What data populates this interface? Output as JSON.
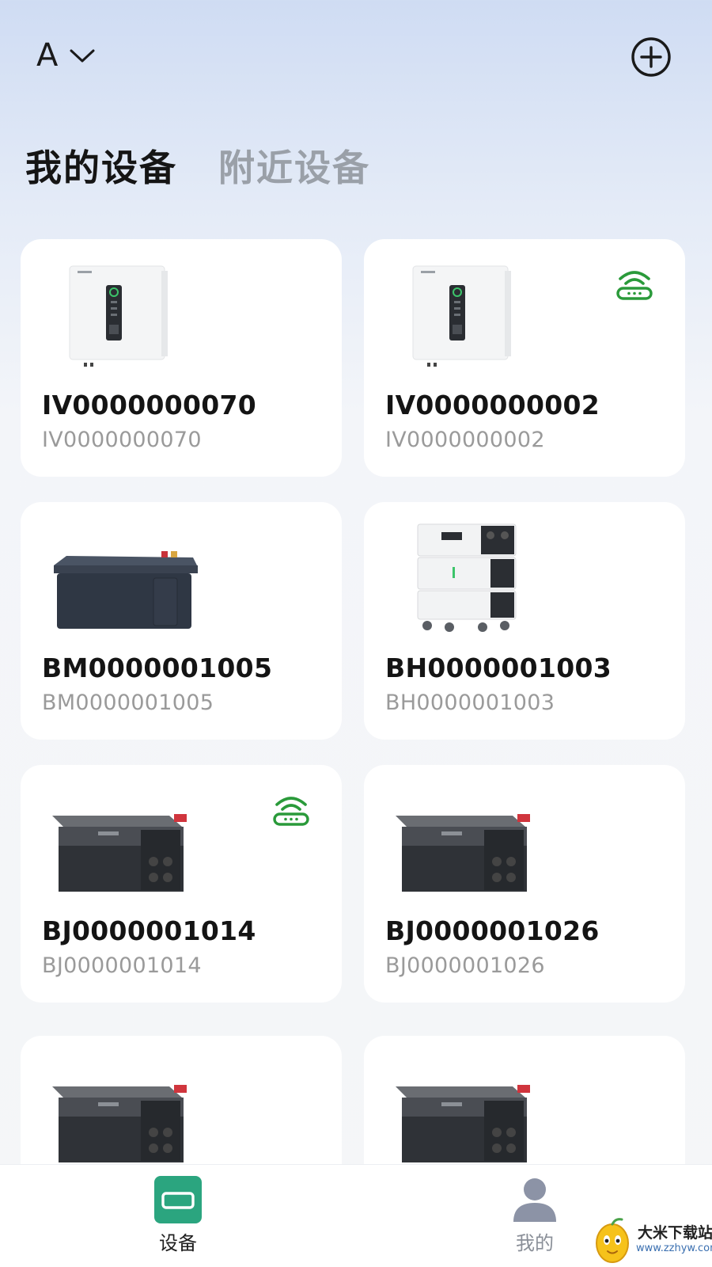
{
  "header": {
    "home_name": "A",
    "icons": {
      "dropdown": "chevron-down-icon",
      "add": "add-circle-icon"
    }
  },
  "tabs": [
    {
      "label": "我的设备",
      "active": true
    },
    {
      "label": "附近设备",
      "active": false
    }
  ],
  "devices": [
    {
      "name": "IV0000000070",
      "serial": "IV0000000070",
      "image": "inverter-image",
      "online": false
    },
    {
      "name": "IV0000000002",
      "serial": "IV0000000002",
      "image": "inverter-image",
      "online": true
    },
    {
      "name": "BM0000001005",
      "serial": "BM0000001005",
      "image": "battery-box-image",
      "online": false
    },
    {
      "name": "BH0000001003",
      "serial": "BH0000001003",
      "image": "stacked-battery-image",
      "online": false
    },
    {
      "name": "BJ0000001014",
      "serial": "BJ0000001014",
      "image": "power-station-image",
      "online": true
    },
    {
      "name": "BJ0000001026",
      "serial": "BJ0000001026",
      "image": "power-station-image",
      "online": false
    },
    {
      "name": "",
      "serial": "",
      "image": "power-station-image",
      "online": false
    },
    {
      "name": "",
      "serial": "",
      "image": "power-station-image",
      "online": false
    }
  ],
  "bottom_nav": [
    {
      "label": "设备",
      "icon": "device-icon",
      "active": true
    },
    {
      "label": "我的",
      "icon": "user-icon",
      "active": false
    }
  ],
  "watermark": {
    "title": "大米下载站",
    "url": "www.zzhyw.com"
  },
  "colors": {
    "accent": "#2ba57f",
    "online": "#2a9a3a",
    "inactive_tab": "#9aa0a8"
  }
}
